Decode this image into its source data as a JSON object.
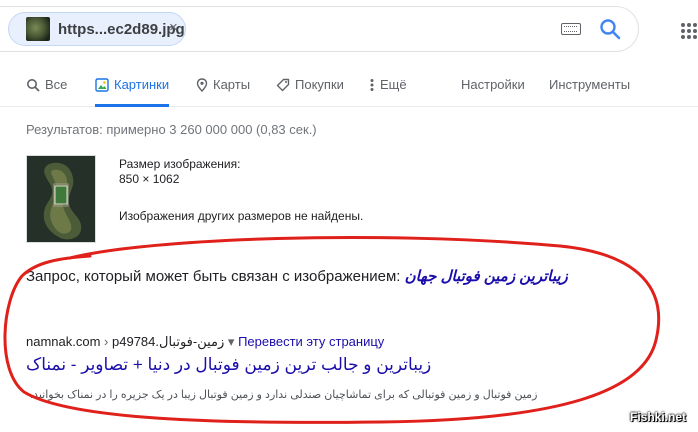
{
  "search": {
    "chip_text": "https...ec2d89.jpg",
    "close_glyph": "×"
  },
  "tabs": [
    {
      "label": "Все",
      "icon": "search-icon"
    },
    {
      "label": "Картинки",
      "icon": "image-icon",
      "active": true
    },
    {
      "label": "Карты",
      "icon": "map-pin-icon"
    },
    {
      "label": "Покупки",
      "icon": "tag-icon"
    },
    {
      "label": "Ещё",
      "icon": "more-vert-icon"
    },
    {
      "label": "Настройки"
    },
    {
      "label": "Инструменты"
    }
  ],
  "results_count": "Результатов: примерно 3 260 000 000 (0,83 сек.)",
  "image_info": {
    "size_label": "Размер изображения:",
    "size_value": "850 × 1062",
    "no_other_sizes": "Изображения других размеров не найдены."
  },
  "query": {
    "prefix": "Запрос, который может быть связан с изображением:",
    "link": "زیباترین زمین فوتبال جهان"
  },
  "result": {
    "site": "namnak.com",
    "path": "p49784.زمین-فوتبال",
    "translate_label": "Перевести эту страницу",
    "title": "زیباترین و جالب ترین زمین فوتبال در دنیا + تصاویر - نمناک",
    "snippet": "زمین فوتبال و زمین فوتبالی که برای تماشاچیان صندلی ندارد و زمین فوتبال زیبا در یک جزیره را در نمناک بخوانید."
  },
  "watermark": "Fishki.net",
  "colors": {
    "link": "#1a0dab",
    "accent": "#1a73e8",
    "annotation": "#e0201a"
  }
}
